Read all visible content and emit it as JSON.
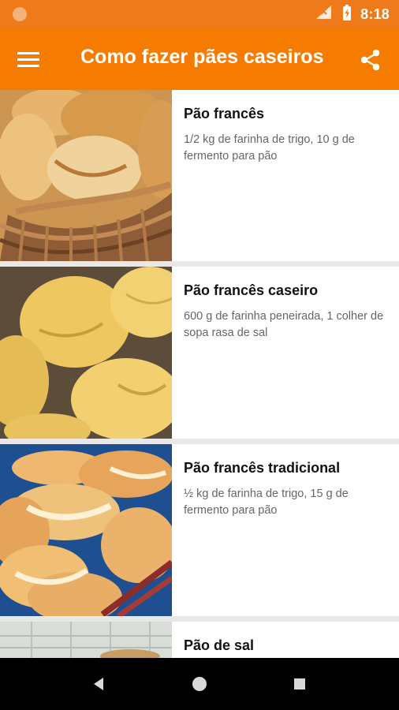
{
  "status_bar": {
    "time": "8:18",
    "notification_icon": "circle-notification-icon",
    "signal_icon": "no-signal-icon",
    "battery_icon": "battery-charging-icon"
  },
  "app_bar": {
    "title": "Como fazer pães caseiros",
    "menu_icon": "menu-icon",
    "share_icon": "share-icon"
  },
  "recipes": [
    {
      "title": "Pão francês",
      "description": "1/2 kg de farinha de trigo, 10 g de fermento para pão",
      "image": "bread-basket-photo"
    },
    {
      "title": "Pão francês caseiro",
      "description": "600 g de farinha peneirada, 1 colher de sopa rasa de sal",
      "image": "raw-dough-rolls-photo"
    },
    {
      "title": "Pão francês tradicional",
      "description": "½ kg de farinha de trigo, 15 g de fermento para pão",
      "image": "baked-rolls-photo"
    },
    {
      "title": "Pão de sal",
      "description": "",
      "image": "bread-counter-photo"
    }
  ],
  "navigation": {
    "back_icon": "back-triangle-icon",
    "home_icon": "home-circle-icon",
    "recents_icon": "recents-square-icon"
  },
  "colors": {
    "status_bar": "#ef7a1a",
    "app_bar": "#f57c00",
    "title_text": "#111111",
    "description_text": "#666666",
    "list_background": "#e8e8e8",
    "navigation_bar": "#000000"
  }
}
